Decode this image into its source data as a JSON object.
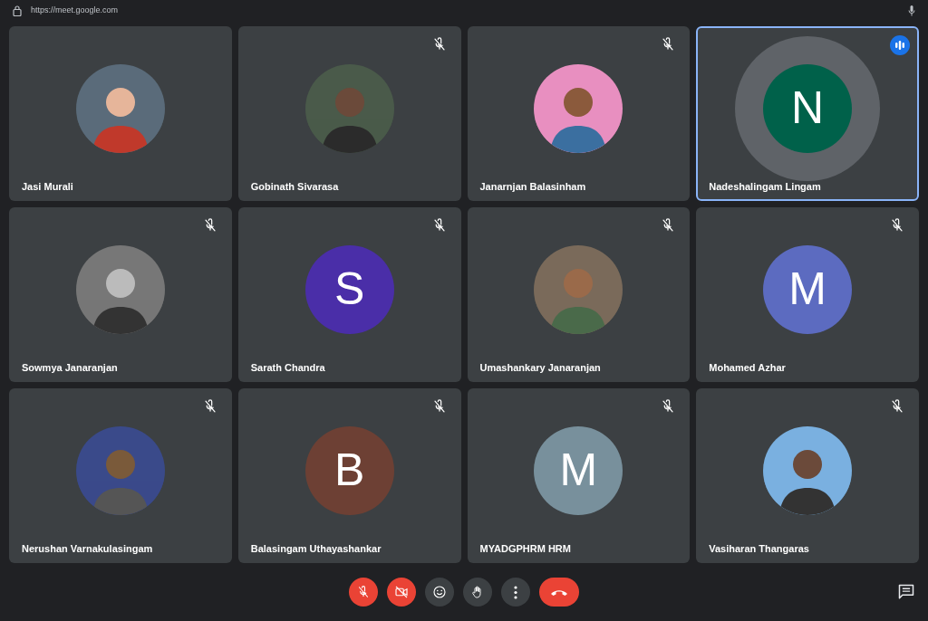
{
  "address_bar": {
    "url": "https://meet.google.com"
  },
  "participants": [
    {
      "name": "Jasi Murali",
      "muted": false,
      "speaking": false
    },
    {
      "name": "Gobinath Sivarasa",
      "muted": true,
      "speaking": false
    },
    {
      "name": "Janarnjan Balasinham",
      "muted": true,
      "speaking": false
    },
    {
      "name": "Nadeshalingam Lingam",
      "muted": false,
      "speaking": true,
      "avatar": {
        "kind": "initial",
        "letter": "N",
        "color": "#00614a"
      }
    },
    {
      "name": "Sowmya Janaranjan",
      "muted": true,
      "speaking": false
    },
    {
      "name": "Sarath Chandra",
      "muted": true,
      "speaking": false,
      "avatar": {
        "kind": "initial",
        "letter": "S",
        "color": "#4a2ea8"
      }
    },
    {
      "name": "Umashankary Janaranjan",
      "muted": true,
      "speaking": false
    },
    {
      "name": "Mohamed Azhar",
      "muted": true,
      "speaking": false,
      "avatar": {
        "kind": "initial",
        "letter": "M",
        "color": "#5c6bc0"
      }
    },
    {
      "name": "Nerushan Varnakulasingam",
      "muted": true,
      "speaking": false
    },
    {
      "name": "Balasingam Uthayashankar",
      "muted": true,
      "speaking": false,
      "avatar": {
        "kind": "initial",
        "letter": "B",
        "color": "#6d4034"
      }
    },
    {
      "name": "MYADGPHRM HRM",
      "muted": true,
      "speaking": false,
      "avatar": {
        "kind": "initial",
        "letter": "M",
        "color": "#78909c"
      }
    },
    {
      "name": "Vasiharan Thangaras",
      "muted": true,
      "speaking": false
    }
  ],
  "controls": [
    {
      "kind": "mic",
      "on": false
    },
    {
      "kind": "camera",
      "on": false
    },
    {
      "kind": "emoji"
    },
    {
      "kind": "hand"
    },
    {
      "kind": "more"
    },
    {
      "kind": "hangup"
    }
  ]
}
